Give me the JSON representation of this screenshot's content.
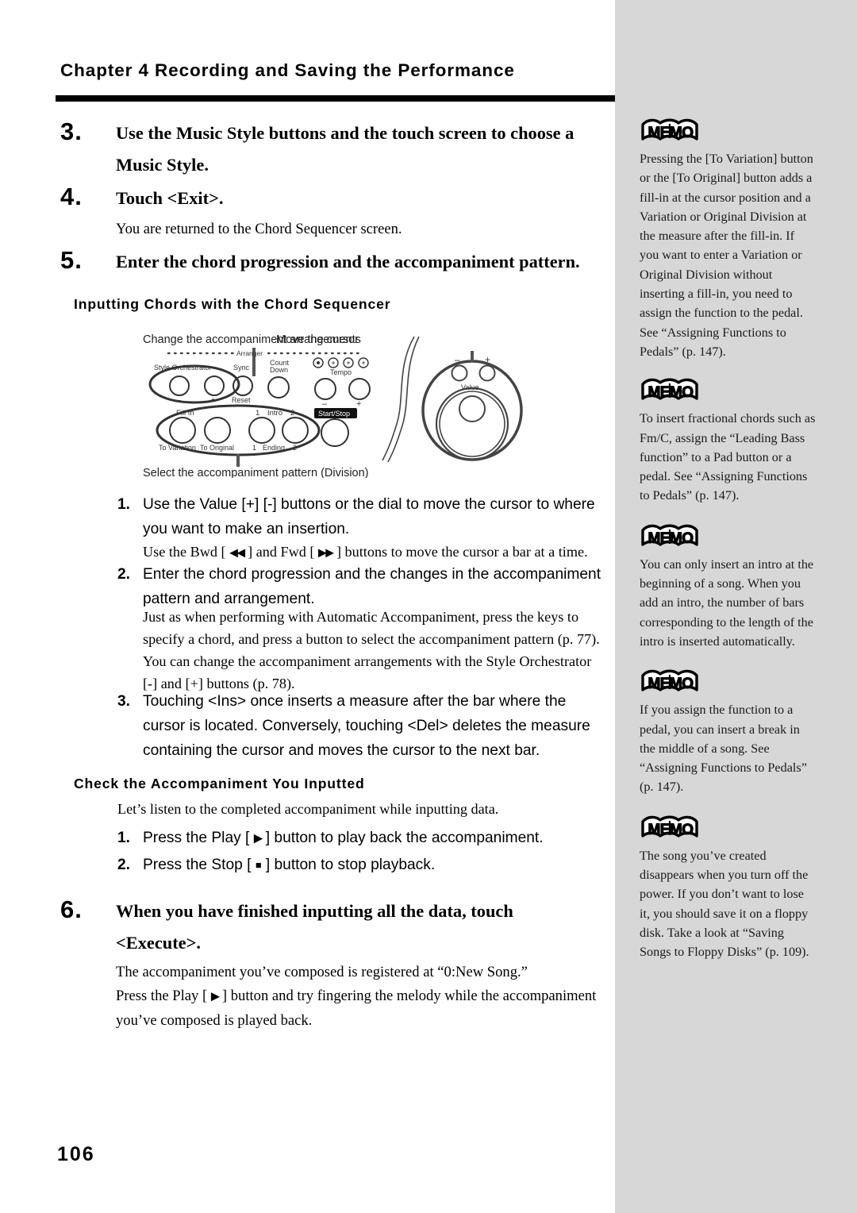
{
  "header": {
    "chapter_title": "Chapter 4 Recording and Saving the Performance"
  },
  "page_number": "106",
  "steps": [
    {
      "number": "3.",
      "heading": "Use the Music Style buttons and the touch screen to choose a Music Style.",
      "body": ""
    },
    {
      "number": "4.",
      "heading": "Touch <Exit>.",
      "body": "You are returned to the Chord Sequencer screen."
    },
    {
      "number": "5.",
      "heading": "Enter the chord progression and the accompaniment pattern.",
      "body": ""
    },
    {
      "number": "6.",
      "heading": "When you have finished inputting all the data, touch <Execute>.",
      "body_line1": "The accompaniment you’ve composed is registered at “0:New Song.”",
      "body_line2_pre": "Press the Play [ ",
      "body_line2_post": " ] button and try fingering the melody while the accompaniment you’ve composed is played back."
    }
  ],
  "section_a": {
    "heading": "Inputting Chords with the Chord Sequencer",
    "items": [
      {
        "marker": "1.",
        "text": "Use the Value [+] [-] buttons or the dial to move the cursor to where you want to make an insertion.",
        "note_pre": "Use the Bwd [ ",
        "note_mid": " ] and Fwd [ ",
        "note_post": " ] buttons to move the cursor a bar at a time."
      },
      {
        "marker": "2.",
        "text": "Enter the chord progression and the changes in the accompaniment pattern and arrangement.",
        "note": "Just as when performing with Automatic Accompaniment, press the keys to specify a chord, and press a button to select the accompaniment pattern (p. 77). You can change the accompaniment arrangements with the Style Orchestrator [-] and [+] buttons (p. 78)."
      },
      {
        "marker": "3.",
        "text": "Touching <Ins> once inserts a measure after the bar where the cursor is located. Conversely, touching <Del> deletes the measure containing the cursor and moves the cursor to the next bar."
      }
    ]
  },
  "section_b": {
    "heading": "Check the Accompaniment You Inputted",
    "intro": "Let’s listen to the completed accompaniment while inputting data.",
    "items": [
      {
        "marker": "1.",
        "text_pre": "Press the Play [ ",
        "text_post": " ] button to play back the accompaniment."
      },
      {
        "marker": "2.",
        "text_pre": "Press the Stop [ ",
        "text_post": " ] button to stop playback."
      }
    ]
  },
  "figure": {
    "callout_top_left": "Change the accompaniment arrangements",
    "callout_top_right": "Move the cursor",
    "callout_bottom": "Select the accompaniment pattern (Division)",
    "labels": {
      "arranger": "Arranger",
      "style_orchestrator": "Style Orchestrator",
      "sync": "Sync",
      "reset": "Reset",
      "count_down": "Count\nDown",
      "count": "Count",
      "down": "Down",
      "tempo": "Tempo",
      "tempo_minus": "–",
      "tempo_plus": "+",
      "fill_in": "Fill In",
      "intro": "Intro",
      "intro_1": "1",
      "intro_2": "2",
      "ending": "Ending",
      "ending_1": "1",
      "ending_2": "2",
      "to_variation": "To Variation",
      "to_original": "To Original",
      "start_stop": "Start/Stop",
      "value": "Value",
      "value_minus": "–",
      "value_plus": "+",
      "so_minus": "–",
      "so_plus": "+"
    }
  },
  "memos": [
    {
      "icon": "memo-book-icon",
      "label": "MEMO",
      "text": "Pressing the [To Variation] button or the [To Original] button adds a fill-in at the cursor position and a Variation or Original Division at the measure after the fill-in. If you want to enter a Variation or Original Division without inserting a fill-in, you need to assign the function to the pedal. See “Assigning Functions to Pedals” (p. 147)."
    },
    {
      "icon": "memo-book-icon",
      "label": "MEMO",
      "text": "To insert fractional chords such as Fm/C, assign the “Leading Bass function” to a Pad button or a pedal. See “Assigning Functions to Pedals” (p. 147)."
    },
    {
      "icon": "memo-book-icon",
      "label": "MEMO",
      "text": "You can only insert an intro at the beginning of a song. When you add an intro, the number of bars corresponding to the length of the intro is inserted automatically."
    },
    {
      "icon": "memo-book-icon",
      "label": "MEMO",
      "text": "If you assign the function to a pedal, you can insert a break in the middle of a song. See “Assigning Functions to Pedals” (p. 147)."
    },
    {
      "icon": "memo-book-icon",
      "label": "MEMO",
      "text": "The song you’ve created disappears when you turn off the power. If you don’t want to lose it, you should save it on a floppy disk. Take a look at “Saving Songs to Floppy Disks” (p. 109)."
    }
  ],
  "glyphs": {
    "play": "▶",
    "stop": "■",
    "rewind": "◀◀",
    "forward": "▶▶"
  },
  "colors": {
    "sidebar_bg": "#d7d7d7",
    "rule": "#000000",
    "text": "#000000"
  }
}
